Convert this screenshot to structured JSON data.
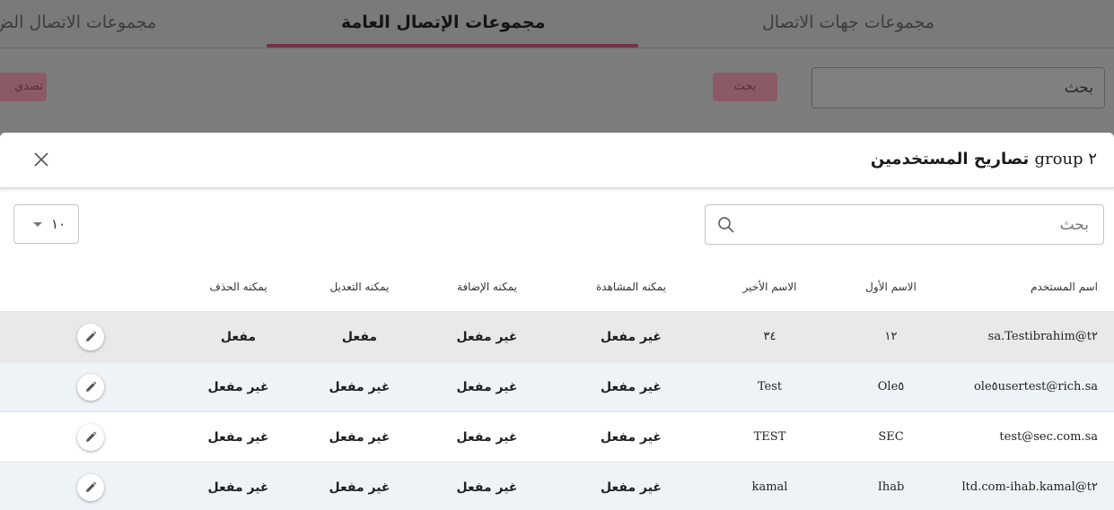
{
  "background": {
    "tabs": [
      {
        "label": "مجموعات جهات الاتصال",
        "active": false
      },
      {
        "label": "مجموعات الإتصال العامة",
        "active": true
      },
      {
        "label": "مجموعات الاتصال الض",
        "active": false
      }
    ],
    "search_value": "بحث",
    "search_button": "بحث",
    "left_button": "تصدي"
  },
  "dialog": {
    "title_prefix": "٢ group",
    "title_text": "تصاريح المستخدمين",
    "search_placeholder": "بحث",
    "page_size": "١٠",
    "columns": {
      "username": "اسم المستخدم",
      "first_name": "الاسم الأول",
      "last_name": "الاسم الأخير",
      "can_view": "يمكنه المشاهدة",
      "can_add": "يمكنه الإضافة",
      "can_edit": "يمكنه التعديل",
      "can_delete": "يمكنه الحذف"
    },
    "rows": [
      {
        "username": "Testibrahim@t٢.sa",
        "first_name": "١٢",
        "last_name": "٣٤",
        "can_view": "غير مفعل",
        "can_add": "غير مفعل",
        "can_edit": "مفعل",
        "can_delete": "مفعل"
      },
      {
        "username": "ole٥usertest@rich.sa",
        "first_name": "Ole٥",
        "last_name": "Test",
        "can_view": "غير مفعل",
        "can_add": "غير مفعل",
        "can_edit": "غير مفعل",
        "can_delete": "غير مفعل"
      },
      {
        "username": "test@sec.com.sa",
        "first_name": "SEC",
        "last_name": "TEST",
        "can_view": "غير مفعل",
        "can_add": "غير مفعل",
        "can_edit": "غير مفعل",
        "can_delete": "غير مفعل"
      },
      {
        "username": "ihab.kamal@t٢-ltd.com",
        "first_name": "Ihab",
        "last_name": "kamal",
        "can_view": "غير مفعل",
        "can_add": "غير مفعل",
        "can_edit": "غير مفعل",
        "can_delete": "غير مفعل"
      }
    ]
  },
  "icons": {
    "close": "close-icon",
    "search": "search-icon",
    "caret": "chevron-down-icon",
    "edit": "pencil-icon"
  },
  "colors": {
    "accent": "#74334a",
    "overlay": "#7d7d7d"
  }
}
